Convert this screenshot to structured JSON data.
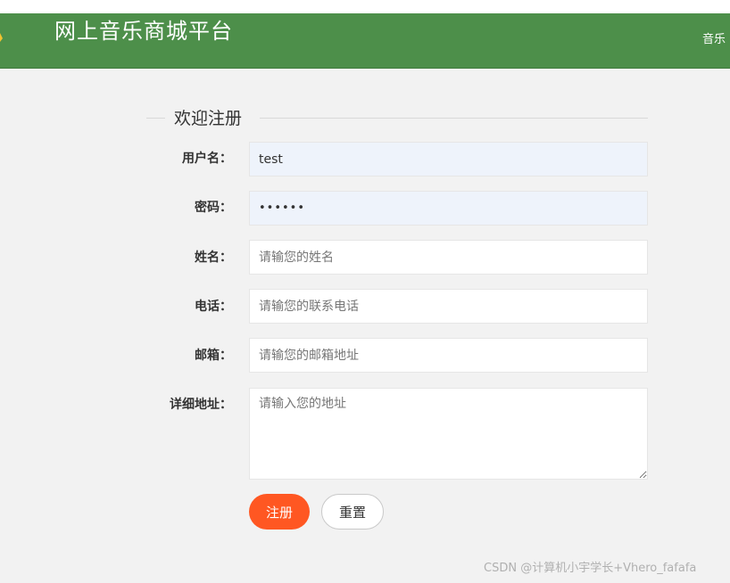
{
  "header": {
    "title": "网上音乐商城平台",
    "nav_link": "音乐",
    "bg_color": "#4d8f4a",
    "logo_icon": "star-icon"
  },
  "form": {
    "legend": "欢迎注册",
    "fields": {
      "username": {
        "label": "用户名：",
        "value": "test",
        "placeholder": ""
      },
      "password": {
        "label": "密码：",
        "value": "••••••",
        "placeholder": ""
      },
      "name": {
        "label": "姓名：",
        "value": "",
        "placeholder": "请输您的姓名"
      },
      "phone": {
        "label": "电话：",
        "value": "",
        "placeholder": "请输您的联系电话"
      },
      "email": {
        "label": "邮箱：",
        "value": "",
        "placeholder": "请输您的邮箱地址"
      },
      "address": {
        "label": "详细地址：",
        "value": "",
        "placeholder": "请输入您的地址"
      }
    },
    "buttons": {
      "register": "注册",
      "reset": "重置"
    },
    "accent_color": "#ff5722"
  },
  "watermark": "CSDN @计算机小宇学长+Vhero_fafafa"
}
